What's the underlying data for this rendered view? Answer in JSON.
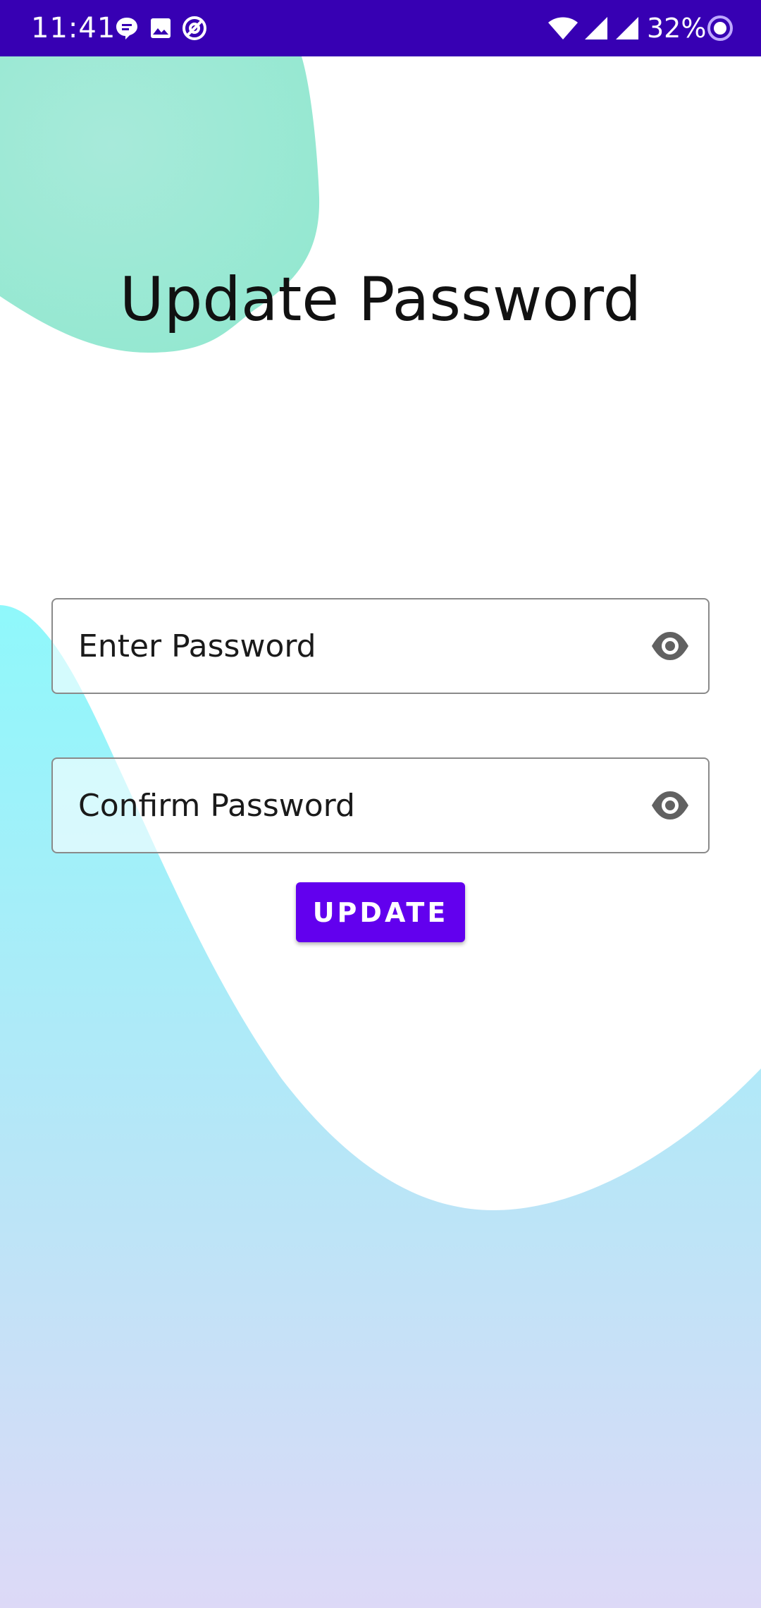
{
  "status_bar": {
    "time": "11:41",
    "battery": "32%",
    "background_color": "#3700b3",
    "icons": [
      "message-icon",
      "image-icon",
      "app-notification-icon",
      "wifi-icon",
      "signal-icon",
      "signal-icon",
      "battery-saver-icon"
    ]
  },
  "page": {
    "title": "Update Password"
  },
  "form": {
    "password": {
      "placeholder": "Enter Password",
      "value": "",
      "toggle_icon": "eye-icon"
    },
    "confirm_password": {
      "placeholder": "Confirm Password",
      "value": "",
      "toggle_icon": "eye-icon"
    },
    "submit_label": "UPDATE"
  },
  "colors": {
    "accent": "#6200ee",
    "status_bar": "#3700b3",
    "blob_green": "#9ce9d4",
    "blob_cyan": "#8ff8fb",
    "blob_lavender": "#ddd9f7"
  }
}
